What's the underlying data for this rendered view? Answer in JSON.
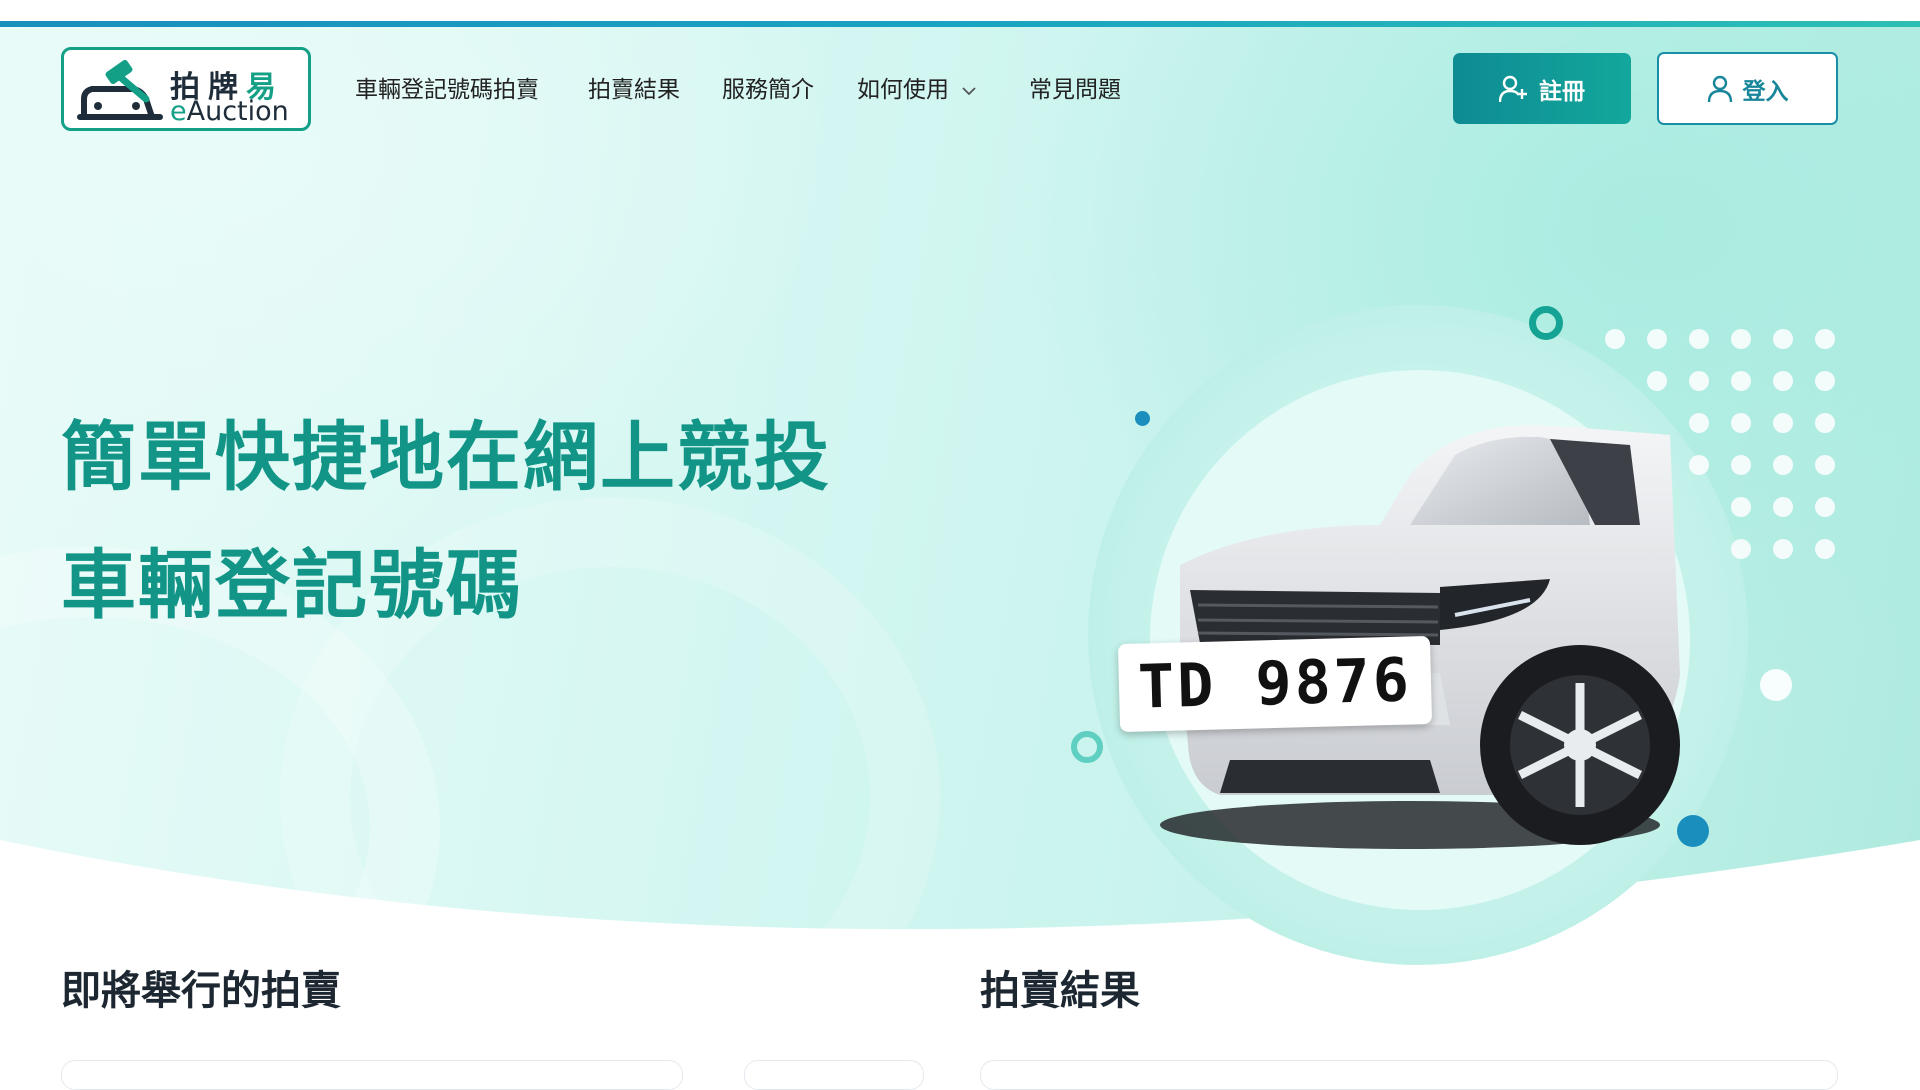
{
  "logo": {
    "name_cn_1": "拍牌",
    "name_cn_2": "易",
    "name_en_1": "e",
    "name_en_2": "Auction"
  },
  "nav": {
    "items": [
      "車輛登記號碼拍賣",
      "拍賣結果",
      "服務簡介",
      "如何使用",
      "常見問題"
    ]
  },
  "buttons": {
    "register": "註冊",
    "login": "登入"
  },
  "hero": {
    "headline_line1": "簡單快捷地在網上競投",
    "headline_line2": "車輛登記號碼",
    "plate_text": "TD 9876"
  },
  "sections": {
    "upcoming_title": "即將舉行的拍賣",
    "results_title": "拍賣結果"
  },
  "colors": {
    "brand_green": "#129587",
    "brand_teal": "#13a79c",
    "login_blue": "#18869a"
  },
  "icons": [
    "gavel-car-icon",
    "add-user-icon",
    "user-icon",
    "chevron-down-icon"
  ]
}
